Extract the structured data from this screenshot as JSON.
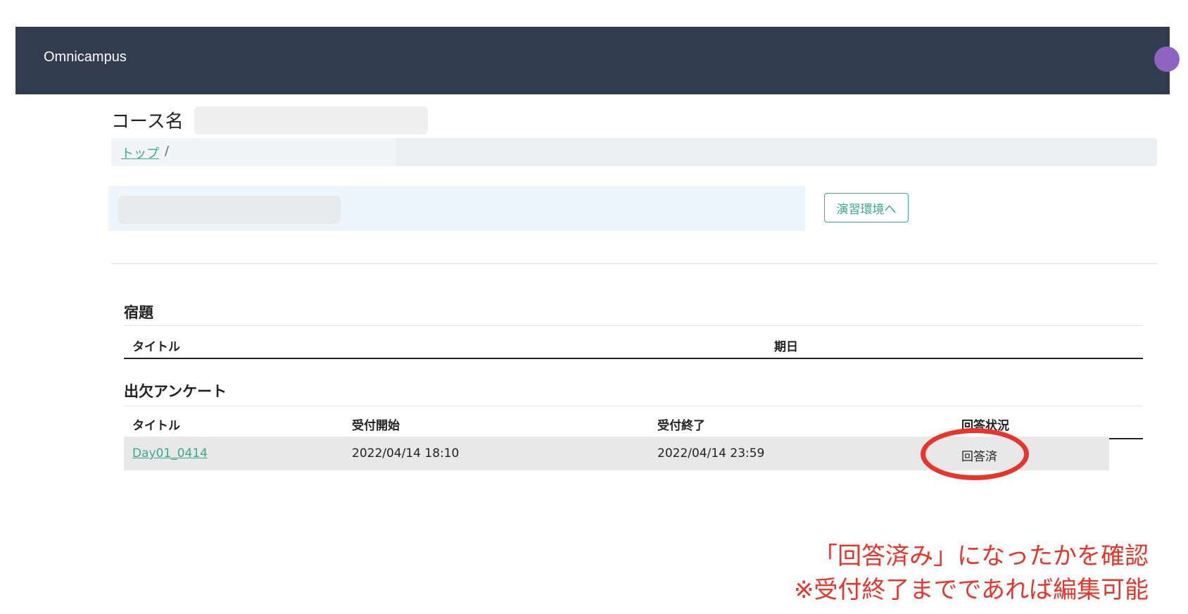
{
  "app": {
    "brand": "Omnicampus"
  },
  "course": {
    "label": "コース名"
  },
  "breadcrumb": {
    "home": "トップ",
    "separator": "/"
  },
  "env_button": {
    "label": "演習環境へ"
  },
  "homework": {
    "title": "宿題",
    "columns": [
      "タイトル",
      "期日"
    ]
  },
  "survey": {
    "title": "出欠アンケート",
    "columns": [
      "タイトル",
      "受付開始",
      "受付終了",
      "回答状況"
    ],
    "rows": [
      {
        "title": "Day01_0414",
        "start": "2022/04/14 18:10",
        "end": "2022/04/14 23:59",
        "status": "回答済"
      }
    ]
  },
  "annotation": {
    "line1": "「回答済み」になったかを確認",
    "line2": "※受付終了までであれば編集可能",
    "color": "#e8352b"
  },
  "colors": {
    "navbar": "#313d4f",
    "accent": "#3aa98a"
  }
}
